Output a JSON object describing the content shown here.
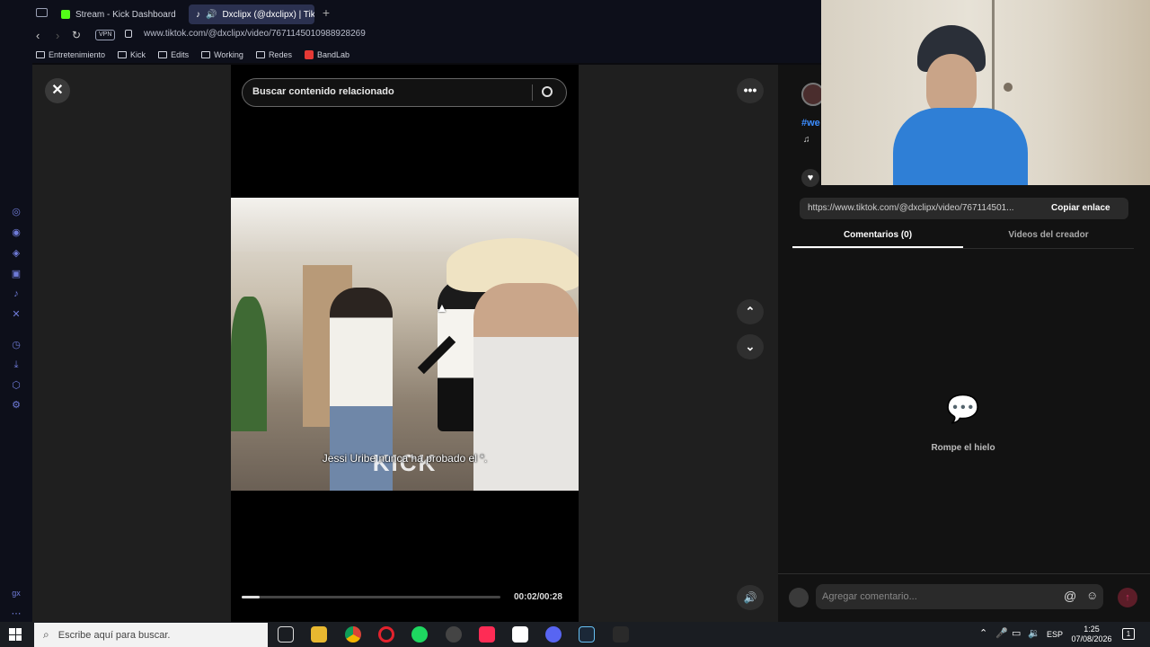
{
  "browser": {
    "tabs": [
      {
        "label": "Stream - Kick Dashboard"
      },
      {
        "label": "Dxclipx (@dxclipx) | Tik"
      }
    ],
    "vpn_label": "VPN",
    "url": "www.tiktok.com/@dxclipx/video/7671145010988928269",
    "bookmarks": [
      "Entretenimiento",
      "Kick",
      "Edits",
      "Working",
      "Redes",
      "BandLab"
    ]
  },
  "search": {
    "placeholder": "Buscar contenido relacionado"
  },
  "video": {
    "caption": "Jessi Uribe nunca ha probado el *.",
    "watermark": "KICK",
    "time": "00:02/00:28",
    "progress_fraction": 0.07
  },
  "panel": {
    "hashtag": "#we",
    "link": "https://www.tiktok.com/@dxclipx/video/767114501...",
    "copy_label": "Copiar enlace",
    "tabs": [
      "Comentarios (0)",
      "Videos del creador"
    ],
    "empty_text": "Rompe el hielo",
    "comment_placeholder": "Agregar comentario..."
  },
  "taskbar": {
    "search_placeholder": "Escribe aquí para buscar.",
    "lang": "ESP",
    "time": "1:25",
    "date": "07/08/2026",
    "notif_count": "1"
  },
  "colors": {
    "accent": "#fe2c55",
    "browser_bg": "#0d0f1a",
    "link_blue": "#3c8dff"
  }
}
